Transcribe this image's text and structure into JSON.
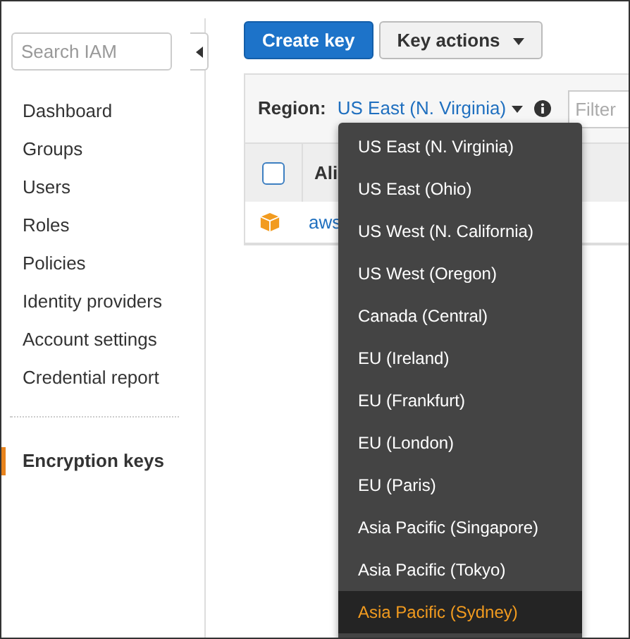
{
  "sidebar": {
    "search": {
      "placeholder": "Search IAM"
    },
    "items": [
      {
        "label": "Dashboard",
        "selected": false
      },
      {
        "label": "Groups",
        "selected": false
      },
      {
        "label": "Users",
        "selected": false
      },
      {
        "label": "Roles",
        "selected": false
      },
      {
        "label": "Policies",
        "selected": false
      },
      {
        "label": "Identity providers",
        "selected": false
      },
      {
        "label": "Account settings",
        "selected": false
      },
      {
        "label": "Credential report",
        "selected": false
      }
    ],
    "bottom_items": [
      {
        "label": "Encryption keys",
        "selected": true
      }
    ]
  },
  "toolbar": {
    "buttons": [
      {
        "label": "Create key",
        "kind": "primary"
      },
      {
        "label": "Key actions",
        "kind": "dropdown"
      }
    ]
  },
  "region": {
    "label": "Region:",
    "value": "US East (N. Virginia)",
    "filter": {
      "placeholder": "Filter"
    }
  },
  "table": {
    "columns": [
      {
        "kind": "checkbox",
        "checked": false
      },
      {
        "label": "Ali",
        "kind": "text"
      }
    ],
    "rows": [
      {
        "alias": "aws"
      }
    ]
  },
  "region_menu": [
    {
      "label": "US East (N. Virginia)",
      "highlighted": false
    },
    {
      "label": "US East (Ohio)",
      "highlighted": false
    },
    {
      "label": "US West (N. California)",
      "highlighted": false
    },
    {
      "label": "US West (Oregon)",
      "highlighted": false
    },
    {
      "label": "Canada (Central)",
      "highlighted": false
    },
    {
      "label": "EU (Ireland)",
      "highlighted": false
    },
    {
      "label": "EU (Frankfurt)",
      "highlighted": false
    },
    {
      "label": "EU (London)",
      "highlighted": false
    },
    {
      "label": "EU (Paris)",
      "highlighted": false
    },
    {
      "label": "Asia Pacific (Singapore)",
      "highlighted": false
    },
    {
      "label": "Asia Pacific (Tokyo)",
      "highlighted": false
    },
    {
      "label": "Asia Pacific (Sydney)",
      "highlighted": true
    }
  ]
}
